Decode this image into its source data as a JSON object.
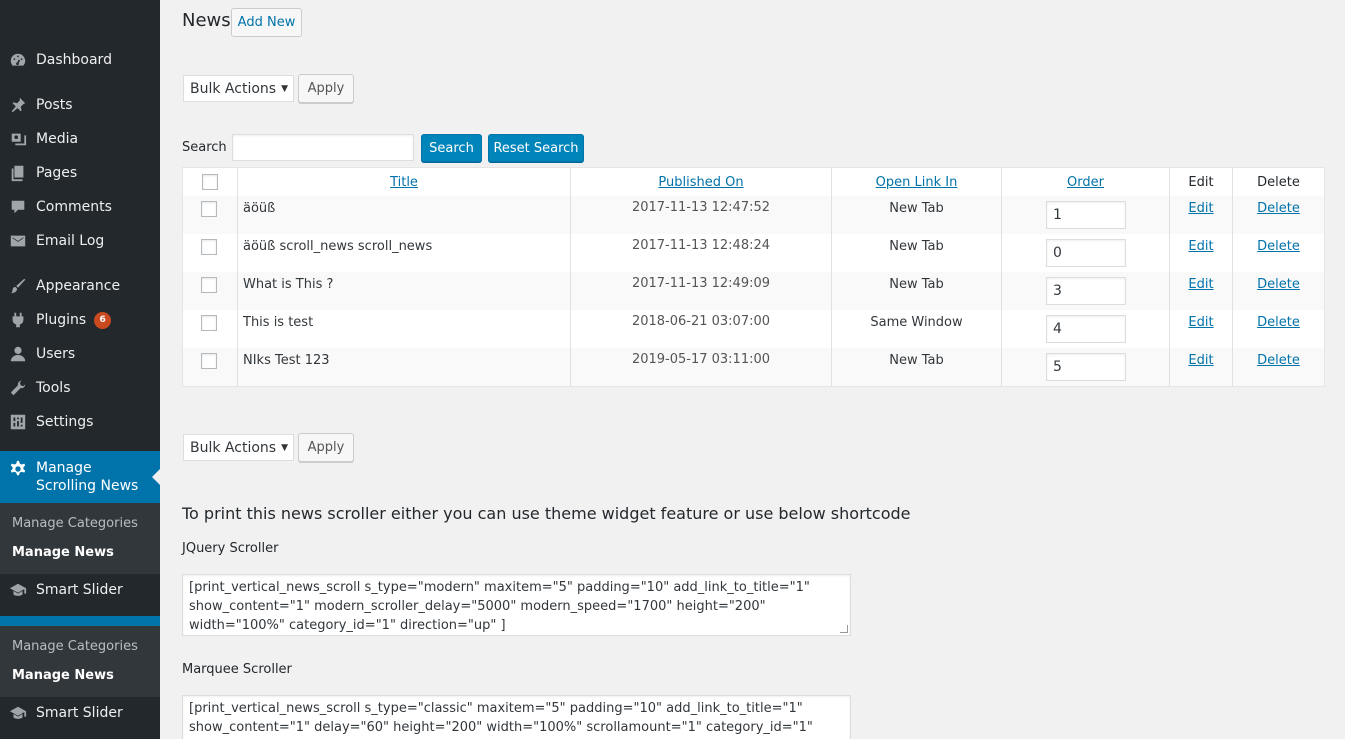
{
  "sidebar": {
    "items": [
      {
        "label": "Dashboard",
        "icon": "dashboard-icon"
      },
      {
        "label": "Posts",
        "icon": "pushpin-icon"
      },
      {
        "label": "Media",
        "icon": "media-icon"
      },
      {
        "label": "Pages",
        "icon": "pages-icon"
      },
      {
        "label": "Comments",
        "icon": "comment-icon"
      },
      {
        "label": "Email Log",
        "icon": "envelope-icon"
      },
      {
        "label": "Appearance",
        "icon": "paintbrush-icon"
      },
      {
        "label": "Plugins",
        "icon": "plugin-icon",
        "badge": "6"
      },
      {
        "label": "Users",
        "icon": "user-icon"
      },
      {
        "label": "Tools",
        "icon": "wrench-icon"
      },
      {
        "label": "Settings",
        "icon": "settings-sliders-icon"
      }
    ],
    "active": {
      "label": "Manage Scrolling News",
      "icon": "gear-icon"
    },
    "submenu1": [
      "Manage Categories",
      "Manage News"
    ],
    "smart_slider_1": "Smart Slider",
    "submenu2": [
      "Manage Categories",
      "Manage News"
    ],
    "smart_slider_2": "Smart Slider"
  },
  "header": {
    "title": "News",
    "add_new": "Add New"
  },
  "bulk": {
    "select_value": "Bulk Actions",
    "apply": "Apply"
  },
  "search": {
    "label": "Search :",
    "value": "",
    "search_button": "Search",
    "reset_button": "Reset Search"
  },
  "table": {
    "columns": [
      "Title",
      "Published On",
      "Open Link In",
      "Order",
      "Edit",
      "Delete"
    ],
    "rows": [
      {
        "title": "äöüß",
        "published": "2017-11-13 12:47:52",
        "open": "New Tab",
        "order": "1",
        "edit": "Edit",
        "delete": "Delete"
      },
      {
        "title": "äöüß scroll_news scroll_news",
        "published": "2017-11-13 12:48:24",
        "open": "New Tab",
        "order": "0",
        "edit": "Edit",
        "delete": "Delete"
      },
      {
        "title": "What is This ?",
        "published": "2017-11-13 12:49:09",
        "open": "New Tab",
        "order": "3",
        "edit": "Edit",
        "delete": "Delete"
      },
      {
        "title": "This is test",
        "published": "2018-06-21 03:07:00",
        "open": "Same Window",
        "order": "4",
        "edit": "Edit",
        "delete": "Delete"
      },
      {
        "title": "NIks Test 123",
        "published": "2019-05-17 03:11:00",
        "open": "New Tab",
        "order": "5",
        "edit": "Edit",
        "delete": "Delete"
      }
    ]
  },
  "shortcodes": {
    "heading": "To print this news scroller either you can use theme widget feature or use below shortcode",
    "jquery_label": "JQuery Scroller",
    "jquery_code": "[print_vertical_news_scroll s_type=\"modern\" maxitem=\"5\" padding=\"10\" add_link_to_title=\"1\" show_content=\"1\" modern_scroller_delay=\"5000\" modern_speed=\"1700\" height=\"200\" width=\"100%\" category_id=\"1\" direction=\"up\" ]",
    "marquee_label": "Marquee Scroller",
    "marquee_code": "[print_vertical_news_scroll s_type=\"classic\" maxitem=\"5\" padding=\"10\" add_link_to_title=\"1\" show_content=\"1\" delay=\"60\" height=\"200\" width=\"100%\" scrollamount=\"1\" category_id=\"1\""
  },
  "colors": {
    "sidebar_bg": "#23282d",
    "accent": "#0073aa",
    "primary_button": "#0085ba",
    "badge": "#ca4a1f"
  }
}
